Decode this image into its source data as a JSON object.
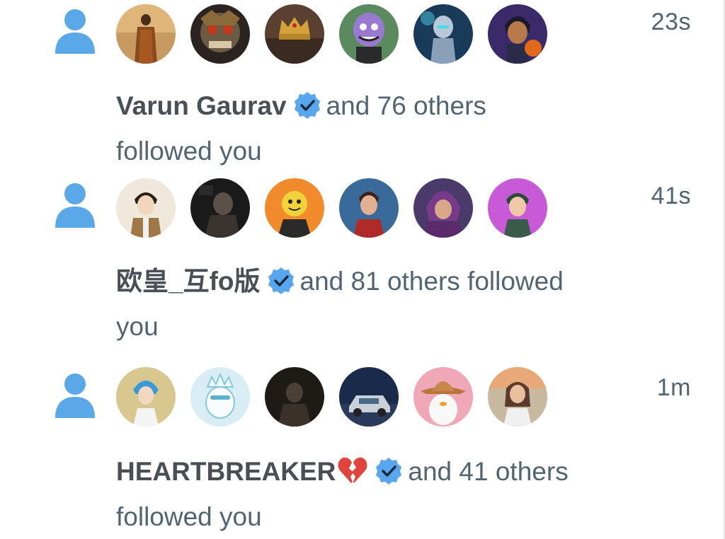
{
  "notifications": [
    {
      "timestamp": "23s",
      "name": "Varun Gaurav",
      "others": "and 76 others",
      "action_text": "followed you",
      "avatar_icons": [
        "monk-avatar",
        "skull-warrior-avatar",
        "crown-avatar",
        "purple-meme-avatar",
        "cyber-robot-avatar",
        "anime-boy-avatar"
      ]
    },
    {
      "timestamp": "41s",
      "name": "欧皇_互fo版",
      "others": "and 81 others followed",
      "action_text": "you",
      "avatar_icons": [
        "anime-soldier-avatar",
        "dark-photo-avatar",
        "yellow-smiley-avatar",
        "cartoon-boy-avatar",
        "magneto-avatar",
        "purple-anime-avatar"
      ]
    },
    {
      "timestamp": "1m",
      "name": "HEARTBREAKER",
      "others": "and 41 others",
      "action_text": "followed you",
      "avatar_icons": [
        "blue-hair-anime-avatar",
        "penguin-crown-avatar",
        "dark-figure-avatar",
        "car-avatar",
        "penguin-cowboy-avatar",
        "woman-photo-avatar"
      ]
    }
  ],
  "colors": {
    "person_icon": "#5ba8e8",
    "verified_badge": "#58a6ee",
    "text_secondary": "#536471",
    "name_text": "#4a4f55"
  }
}
